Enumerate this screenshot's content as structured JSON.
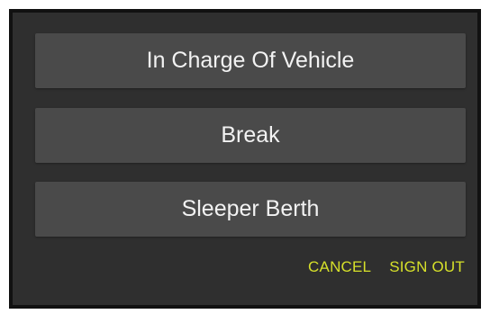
{
  "dialog": {
    "options": [
      {
        "label": "In Charge Of Vehicle"
      },
      {
        "label": "Break"
      },
      {
        "label": "Sleeper Berth"
      }
    ],
    "actions": {
      "cancel_label": "CANCEL",
      "sign_out_label": "SIGN OUT"
    }
  },
  "colors": {
    "background": "#2f2f2f",
    "button": "#4a4a4a",
    "accent": "#d6e02a",
    "text": "#f2f2f2"
  }
}
